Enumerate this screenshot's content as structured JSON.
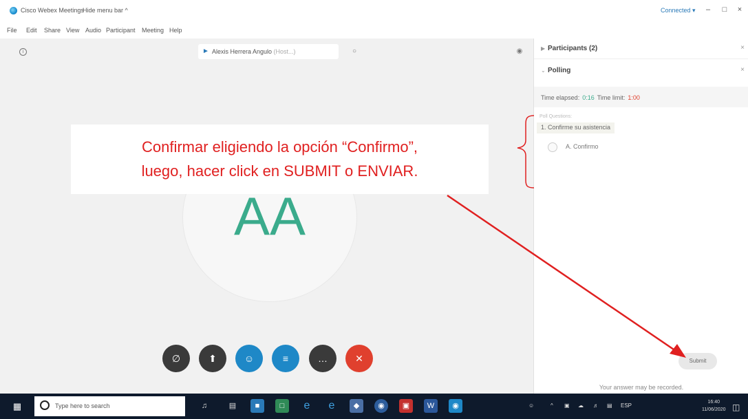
{
  "titlebar": {
    "app_title": "Cisco Webex Meetings",
    "hide_menu": "Hide menu bar ^",
    "connection_status": "Connected ▾",
    "minimize": "–",
    "maximize": "□",
    "close": "×"
  },
  "menu": [
    "File",
    "Edit",
    "Share",
    "View",
    "Audio",
    "Participant",
    "Meeting",
    "Help"
  ],
  "main": {
    "speaker_name": "Alexis Herrera Angulo",
    "speaker_role": " (Host...)",
    "avatar_initials": "AA"
  },
  "controls": {
    "mute_icon": "∅",
    "share_icon": "⬆",
    "participants_icon": "☺",
    "poll_icon": "≡",
    "more_icon": "…",
    "leave_icon": "✕"
  },
  "annotation": {
    "line1": "Confirmar eligiendo la opción “Confirmo”,",
    "line2": "luego, hacer click en SUBMIT o ENVIAR."
  },
  "panel": {
    "participants_title": "Participants (2)",
    "polling_title": "Polling",
    "time_elapsed_label": "Time elapsed:",
    "time_elapsed_value": "0:16",
    "time_limit_label": "Time limit:",
    "time_limit_value": "1:00",
    "poll_questions_label": "Poll Questions:",
    "question": "1. Confirme su asistencia",
    "option": "A. Confirmo",
    "submit": "Submit",
    "record_note": "Your answer may be recorded."
  },
  "taskbar": {
    "search_placeholder": "Type here to search",
    "language": "ESP",
    "time": "16:40",
    "date": "11/06/2020"
  },
  "colors": {
    "accent_blue": "#1e88c7",
    "leave_red": "#e0402e",
    "avatar_green": "#3bab8c",
    "annotation_red": "#e02020"
  }
}
